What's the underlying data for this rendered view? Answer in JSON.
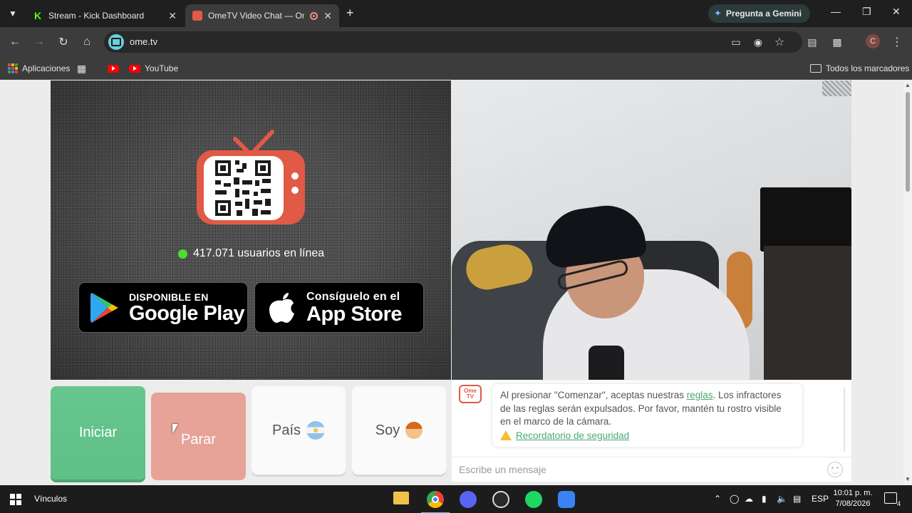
{
  "browser": {
    "tabs": [
      {
        "title": "Stream - Kick Dashboard",
        "favicon": "kick-icon",
        "active": false
      },
      {
        "title": "OmeTV Video Chat — Ome",
        "favicon": "ometv-icon",
        "active": true
      }
    ],
    "gemini_label": "Pregunta a Gemini",
    "url": "ome.tv",
    "profile_initial": "C",
    "bookmarks": {
      "apps_label": "Aplicaciones",
      "youtube_label": "YouTube",
      "all_bookmarks_label": "Todos los marcadores"
    }
  },
  "page": {
    "online": {
      "count_text": "417.071 usuarios en línea",
      "status_color": "#4fdb35"
    },
    "google_play": {
      "line1": "DISPONIBLE EN",
      "line2": "Google Play"
    },
    "app_store": {
      "line1": "Consíguelo en el",
      "line2": "App Store"
    },
    "controls": {
      "start_label": "Iniciar",
      "stop_label": "Parar",
      "country_label": "País",
      "country_flag": "argentina-flag-icon",
      "iam_label": "Soy",
      "iam_icon": "boy-emoji-icon"
    },
    "chat": {
      "logo_line1": "Ome",
      "logo_line2": "TV",
      "notice_before": "Al presionar \"Comenzar\", aceptas nuestras ",
      "notice_link": "reglas",
      "notice_after": ". Los infractores de las reglas serán expulsados. Por favor, mantén tu rostro visible en el marco de la cámara.",
      "safety_link": "Recordatorio de seguridad",
      "input_placeholder": "Escribe un mensaje"
    },
    "colors": {
      "start": "#66c68d",
      "stop": "#e7a398",
      "brand": "#e05a45",
      "link": "#4aa772"
    }
  },
  "taskbar": {
    "label": "Vínculos",
    "language": "ESP",
    "time": "10:01 p. m.",
    "date": "7/08/2026",
    "notification_count": "4"
  }
}
